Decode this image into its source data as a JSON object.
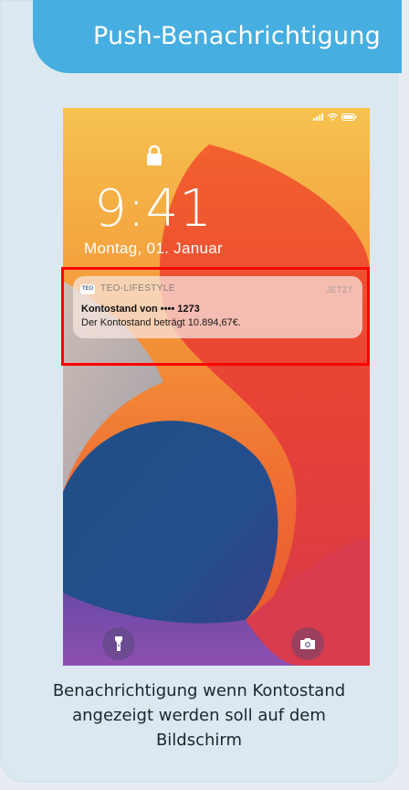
{
  "header": {
    "title": "Push-Benachrichtigung",
    "color": "#46aee0"
  },
  "lockscreen": {
    "time": "9:41",
    "date": "Montag, 01. Januar",
    "status_icons": [
      "cellular-signal-icon",
      "wifi-icon",
      "battery-icon"
    ]
  },
  "notification": {
    "app_icon_text": "TEO",
    "app_name": "TEO-LIFESTYLE",
    "time_label": "JETZT",
    "title": "Kontostand von •••• 1273",
    "body": "Der Kontostand beträgt 10.894,67€.",
    "highlight_color": "#ff0000"
  },
  "bottom_buttons": [
    "flashlight-icon",
    "camera-icon"
  ],
  "caption": {
    "line1": "Benachrichtigung wenn Kontostand",
    "line2": "angezeigt werden soll auf dem",
    "line3": "Bildschirm"
  }
}
